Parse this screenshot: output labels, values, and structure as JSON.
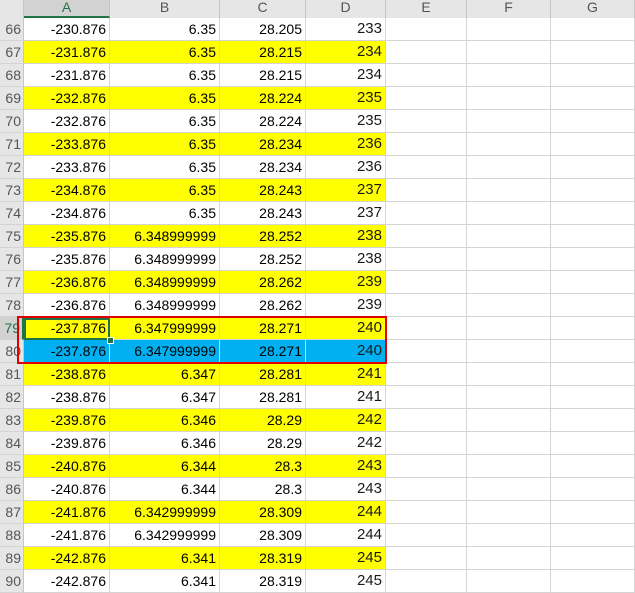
{
  "columns": [
    {
      "id": "col-A",
      "label": "A",
      "selected": true
    },
    {
      "id": "col-B",
      "label": "B",
      "selected": false
    },
    {
      "id": "col-C",
      "label": "C",
      "selected": false
    },
    {
      "id": "col-D",
      "label": "D",
      "selected": false
    },
    {
      "id": "col-E",
      "label": "E",
      "selected": false
    },
    {
      "id": "col-F",
      "label": "F",
      "selected": false
    },
    {
      "id": "col-G",
      "label": "G",
      "selected": false
    }
  ],
  "colors": {
    "yellow": "#ffff00",
    "blue": "#00b0f0",
    "highlight_border": "#e00000",
    "selection_green": "#217346"
  },
  "rows": [
    {
      "num": "66",
      "a": "-230.876",
      "b": "6.35",
      "c": "28.205",
      "d": "233",
      "fill": "white",
      "selected": false
    },
    {
      "num": "67",
      "a": "-231.876",
      "b": "6.35",
      "c": "28.215",
      "d": "234",
      "fill": "yellow",
      "selected": false
    },
    {
      "num": "68",
      "a": "-231.876",
      "b": "6.35",
      "c": "28.215",
      "d": "234",
      "fill": "white",
      "selected": false
    },
    {
      "num": "69",
      "a": "-232.876",
      "b": "6.35",
      "c": "28.224",
      "d": "235",
      "fill": "yellow",
      "selected": false
    },
    {
      "num": "70",
      "a": "-232.876",
      "b": "6.35",
      "c": "28.224",
      "d": "235",
      "fill": "white",
      "selected": false
    },
    {
      "num": "71",
      "a": "-233.876",
      "b": "6.35",
      "c": "28.234",
      "d": "236",
      "fill": "yellow",
      "selected": false
    },
    {
      "num": "72",
      "a": "-233.876",
      "b": "6.35",
      "c": "28.234",
      "d": "236",
      "fill": "white",
      "selected": false
    },
    {
      "num": "73",
      "a": "-234.876",
      "b": "6.35",
      "c": "28.243",
      "d": "237",
      "fill": "yellow",
      "selected": false
    },
    {
      "num": "74",
      "a": "-234.876",
      "b": "6.35",
      "c": "28.243",
      "d": "237",
      "fill": "white",
      "selected": false
    },
    {
      "num": "75",
      "a": "-235.876",
      "b": "6.348999999",
      "c": "28.252",
      "d": "238",
      "fill": "yellow",
      "selected": false
    },
    {
      "num": "76",
      "a": "-235.876",
      "b": "6.348999999",
      "c": "28.252",
      "d": "238",
      "fill": "white",
      "selected": false
    },
    {
      "num": "77",
      "a": "-236.876",
      "b": "6.348999999",
      "c": "28.262",
      "d": "239",
      "fill": "yellow",
      "selected": false
    },
    {
      "num": "78",
      "a": "-236.876",
      "b": "6.348999999",
      "c": "28.262",
      "d": "239",
      "fill": "white",
      "selected": false
    },
    {
      "num": "79",
      "a": "-237.876",
      "b": "6.347999999",
      "c": "28.271",
      "d": "240",
      "fill": "yellow",
      "selected": true
    },
    {
      "num": "80",
      "a": "-237.876",
      "b": "6.347999999",
      "c": "28.271",
      "d": "240",
      "fill": "blue",
      "selected": false
    },
    {
      "num": "81",
      "a": "-238.876",
      "b": "6.347",
      "c": "28.281",
      "d": "241",
      "fill": "yellow",
      "selected": false
    },
    {
      "num": "82",
      "a": "-238.876",
      "b": "6.347",
      "c": "28.281",
      "d": "241",
      "fill": "white",
      "selected": false
    },
    {
      "num": "83",
      "a": "-239.876",
      "b": "6.346",
      "c": "28.29",
      "d": "242",
      "fill": "yellow",
      "selected": false
    },
    {
      "num": "84",
      "a": "-239.876",
      "b": "6.346",
      "c": "28.29",
      "d": "242",
      "fill": "white",
      "selected": false
    },
    {
      "num": "85",
      "a": "-240.876",
      "b": "6.344",
      "c": "28.3",
      "d": "243",
      "fill": "yellow",
      "selected": false
    },
    {
      "num": "86",
      "a": "-240.876",
      "b": "6.344",
      "c": "28.3",
      "d": "243",
      "fill": "white",
      "selected": false
    },
    {
      "num": "87",
      "a": "-241.876",
      "b": "6.342999999",
      "c": "28.309",
      "d": "244",
      "fill": "yellow",
      "selected": false
    },
    {
      "num": "88",
      "a": "-241.876",
      "b": "6.342999999",
      "c": "28.309",
      "d": "244",
      "fill": "white",
      "selected": false
    },
    {
      "num": "89",
      "a": "-242.876",
      "b": "6.341",
      "c": "28.319",
      "d": "245",
      "fill": "yellow",
      "selected": false
    },
    {
      "num": "90",
      "a": "-242.876",
      "b": "6.341",
      "c": "28.319",
      "d": "245",
      "fill": "white",
      "selected": false
    }
  ]
}
